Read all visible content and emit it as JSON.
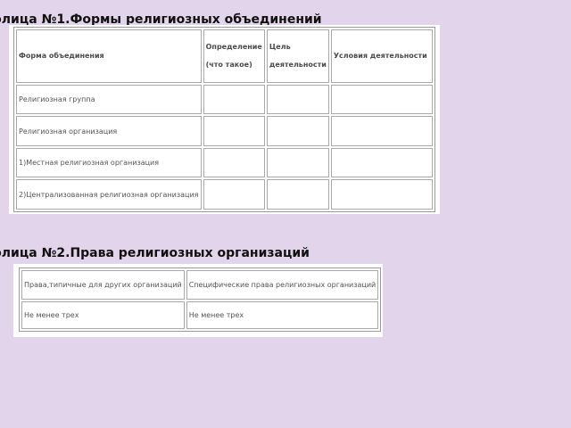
{
  "table1": {
    "heading": "блица №1.Формы религиозных объединений",
    "headers": [
      "Форма объединения",
      "Определение (что такое)",
      "Цель деятельности",
      "Условия деятельности"
    ],
    "rows": [
      [
        "Религиозная группа",
        "",
        "",
        ""
      ],
      [
        "Религиозная организация",
        "",
        "",
        ""
      ],
      [
        "1)Местная религиозная организация",
        "",
        "",
        ""
      ],
      [
        "2)Централизованная религиозная организация",
        "",
        "",
        ""
      ]
    ]
  },
  "table2": {
    "heading": "блица №2.Права религиозных организаций",
    "headers": [
      "Права,типичные для других организаций",
      "Специфические права религиозных организаций"
    ],
    "rows": [
      [
        "Не менее трех",
        "Не менее трех"
      ]
    ]
  }
}
